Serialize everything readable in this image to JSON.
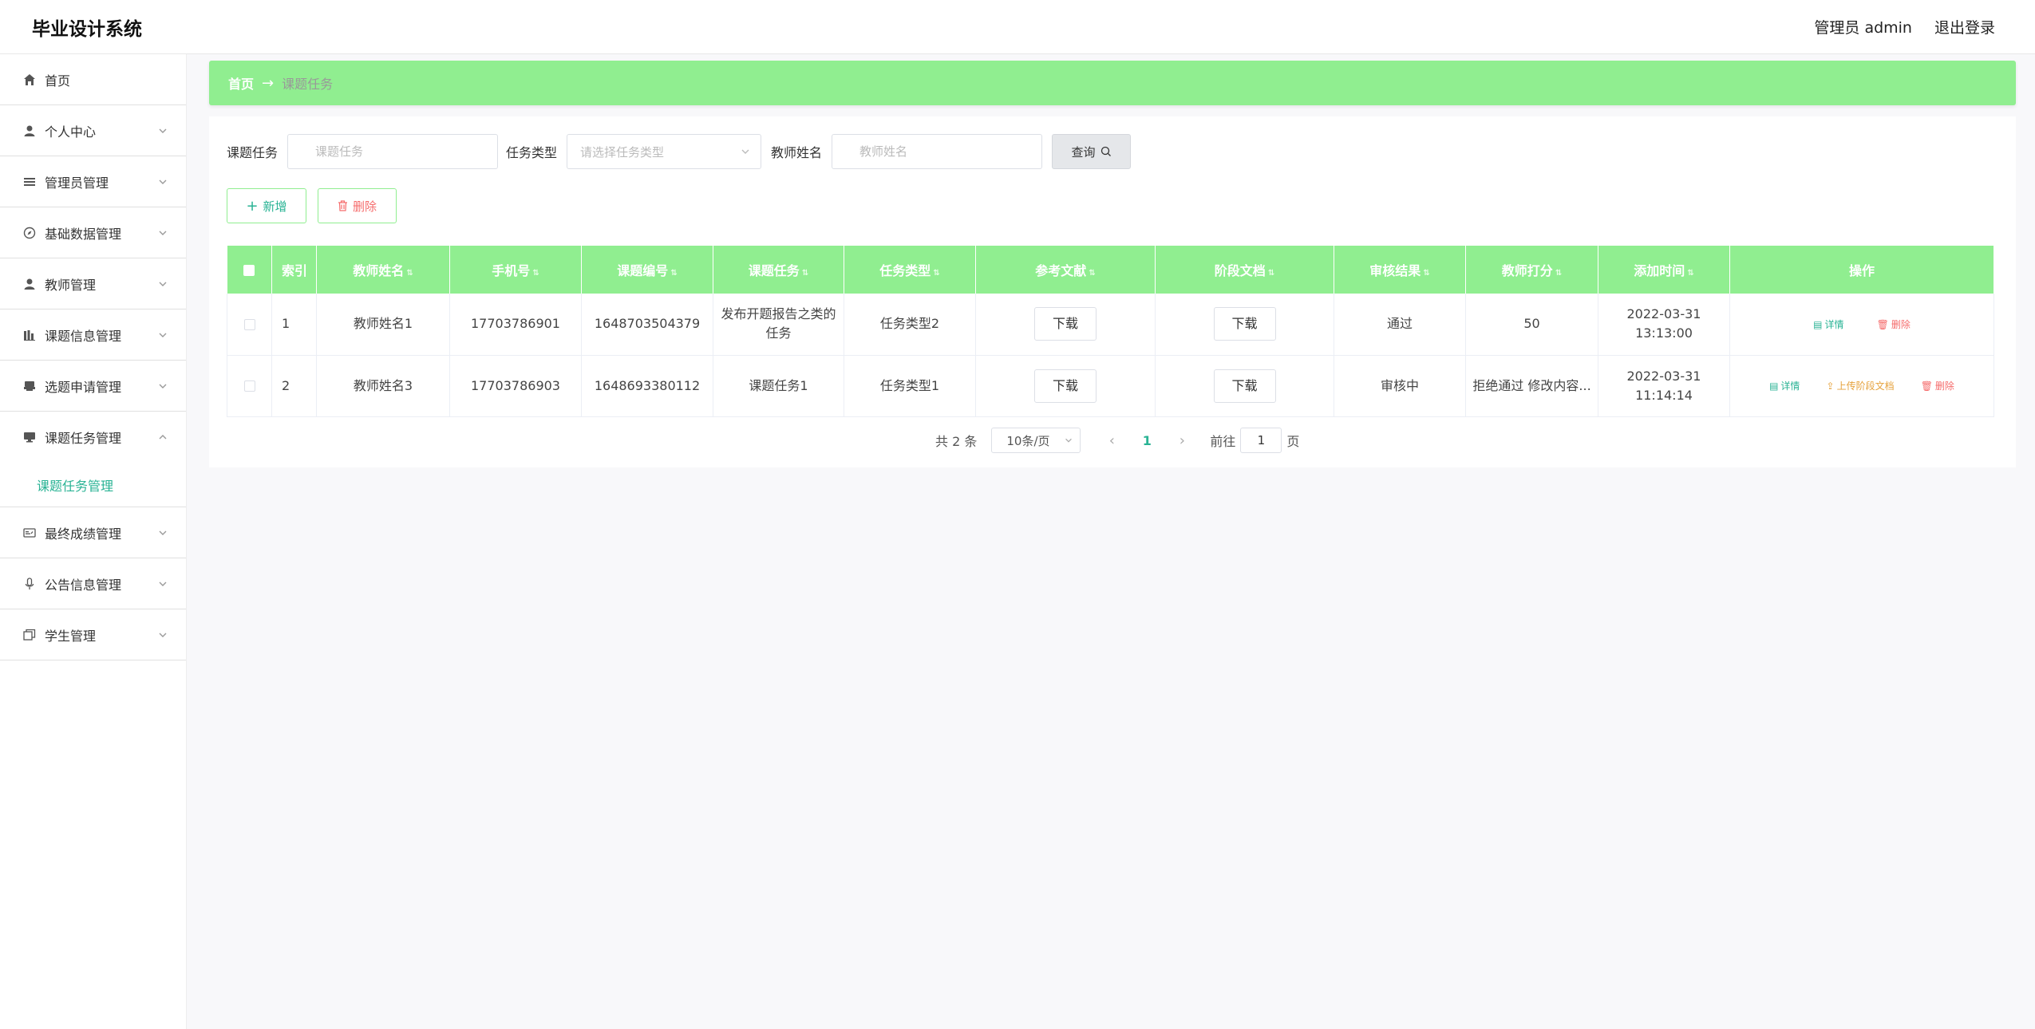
{
  "header": {
    "title": "毕业设计系统",
    "user": "管理员 admin",
    "logout": "退出登录"
  },
  "sidebar": {
    "items": [
      {
        "label": "首页",
        "icon": "home-icon"
      },
      {
        "label": "个人中心",
        "icon": "user-icon"
      },
      {
        "label": "管理员管理",
        "icon": "list-icon"
      },
      {
        "label": "基础数据管理",
        "icon": "compass-icon"
      },
      {
        "label": "教师管理",
        "icon": "user-icon"
      },
      {
        "label": "课题信息管理",
        "icon": "bar-chart-icon"
      },
      {
        "label": "选题申请管理",
        "icon": "printer-icon"
      },
      {
        "label": "课题任务管理",
        "icon": "monitor-icon"
      },
      {
        "label": "最终成绩管理",
        "icon": "id-card-icon"
      },
      {
        "label": "公告信息管理",
        "icon": "microphone-icon"
      },
      {
        "label": "学生管理",
        "icon": "copy-icon"
      }
    ],
    "sub_active": "课题任务管理"
  },
  "breadcrumb": {
    "home": "首页",
    "current": "课题任务"
  },
  "search": {
    "task_label": "课题任务",
    "task_placeholder": "课题任务",
    "type_label": "任务类型",
    "type_placeholder": "请选择任务类型",
    "teacher_label": "教师姓名",
    "teacher_placeholder": "教师姓名",
    "query": "查询"
  },
  "actions": {
    "add": "新增",
    "delete": "删除"
  },
  "table": {
    "headers": [
      "索引",
      "教师姓名",
      "手机号",
      "课题编号",
      "课题任务",
      "任务类型",
      "参考文献",
      "阶段文档",
      "审核结果",
      "教师打分",
      "添加时间",
      "操作"
    ],
    "rows": [
      {
        "index": "1",
        "teacher": "教师姓名1",
        "phone": "17703786901",
        "code": "1648703504379",
        "task": "发布开题报告之类的任务",
        "type": "任务类型2",
        "ref": "下载",
        "doc": "下载",
        "result": "通过",
        "score": "50",
        "time": "2022-03-31 13:13:00"
      },
      {
        "index": "2",
        "teacher": "教师姓名3",
        "phone": "17703786903",
        "code": "1648693380112",
        "task": "课题任务1",
        "type": "任务类型1",
        "ref": "下载",
        "doc": "下载",
        "result": "审核中",
        "score": "拒绝通过 修改内容...",
        "time": "2022-03-31 11:14:14"
      }
    ],
    "ops": {
      "detail": "详情",
      "upload": "上传阶段文档",
      "delete": "删除"
    }
  },
  "pager": {
    "total": "共 2 条",
    "size": "10条/页",
    "page": "1",
    "goto": "前往",
    "goto_value": "1",
    "unit": "页"
  },
  "colors": {
    "accent": "#90ee90",
    "active_text": "#29b394",
    "danger": "#f56c6c",
    "warning": "#e6a23c"
  }
}
